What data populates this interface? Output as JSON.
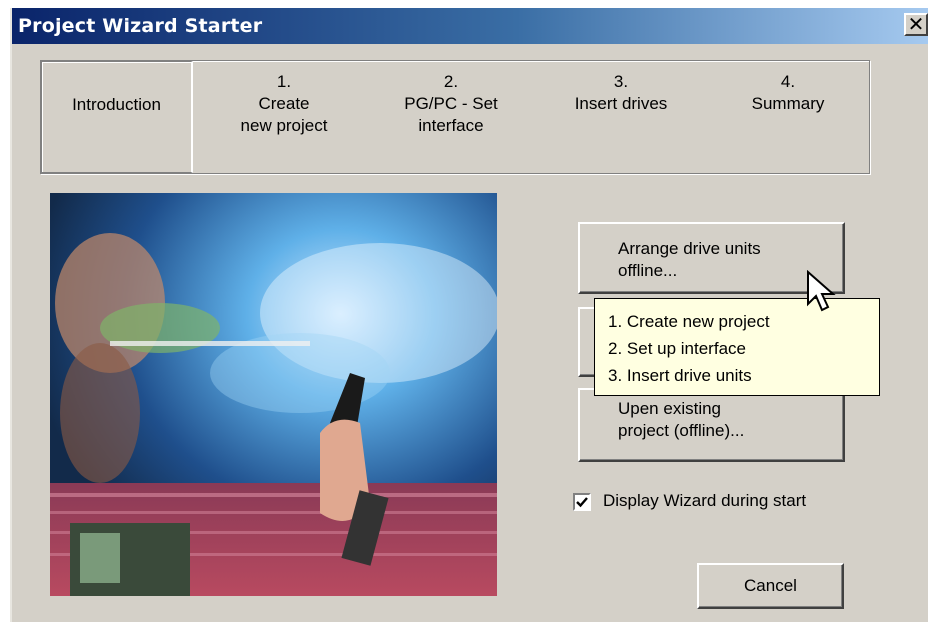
{
  "window": {
    "title": "Project Wizard Starter",
    "close_glyph": "✕"
  },
  "steps": [
    {
      "number": "",
      "lines": [
        "Introduction"
      ]
    },
    {
      "number": "1.",
      "lines": [
        "Create",
        "new project"
      ]
    },
    {
      "number": "2.",
      "lines": [
        "PG/PC - Set",
        "interface"
      ]
    },
    {
      "number": "3.",
      "lines": [
        "Insert drives"
      ]
    },
    {
      "number": "4.",
      "lines": [
        "Summary"
      ]
    }
  ],
  "buttons": {
    "arrange": [
      "Arrange drive units",
      "offline..."
    ],
    "open": [
      "Upen existing",
      "project (offline)..."
    ],
    "cancel": "Cancel"
  },
  "tooltip": [
    "1. Create new project",
    "2. Set up interface",
    "3. Insert drive units"
  ],
  "checkbox": {
    "label": "Display Wizard during start",
    "checked": true
  },
  "icons": {
    "close": "close-icon",
    "cursor": "mouse-cursor-icon",
    "check": "checkmark-icon"
  }
}
